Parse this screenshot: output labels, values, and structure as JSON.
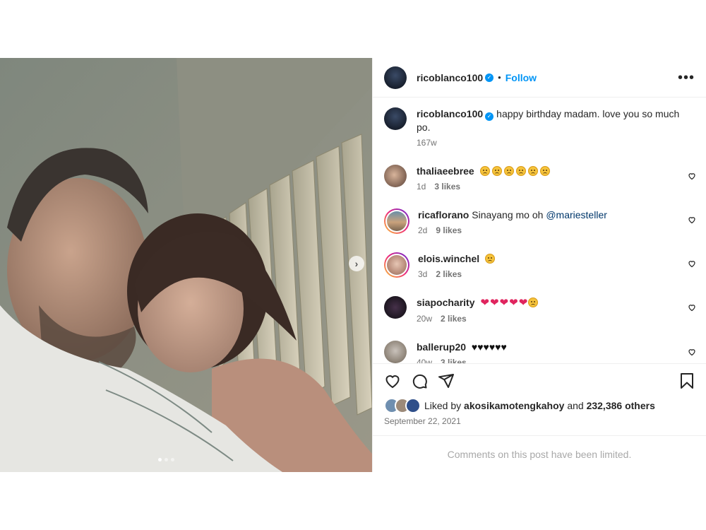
{
  "post": {
    "author": "ricoblanco100",
    "follow_label": "Follow",
    "separator": "•",
    "more_label": "•••",
    "caption": "happy birthday madam. love you so much po.",
    "caption_time": "167w",
    "next_label": "›"
  },
  "comments": [
    {
      "user": "thaliaeebree",
      "text": "",
      "time": "1d",
      "likes": "3 likes"
    },
    {
      "user": "ricaflorano",
      "text": "Sinayang mo oh",
      "mention": "@mariesteller",
      "time": "2d",
      "likes": "9 likes"
    },
    {
      "user": "elois.winchel",
      "text": "",
      "time": "3d",
      "likes": "2 likes"
    },
    {
      "user": "siapocharity",
      "text": "",
      "time": "20w",
      "likes": "2 likes"
    },
    {
      "user": "ballerup20",
      "text": "",
      "time": "40w",
      "likes": "3 likes"
    }
  ],
  "likes": {
    "prefix": "Liked by",
    "user": "akosikamotengkahoy",
    "and": "and",
    "count": "232,386 others"
  },
  "date": "September 22, 2021",
  "limited": "Comments on this post have been limited.",
  "icons": {
    "like": "heart-icon",
    "comment": "comment-bubble-icon",
    "share": "paper-plane-icon",
    "save": "bookmark-icon",
    "verified": "verified-badge-icon"
  },
  "colors": {
    "accent": "#0095f6",
    "text": "#262626",
    "muted": "#737373",
    "mention": "#00376b"
  }
}
